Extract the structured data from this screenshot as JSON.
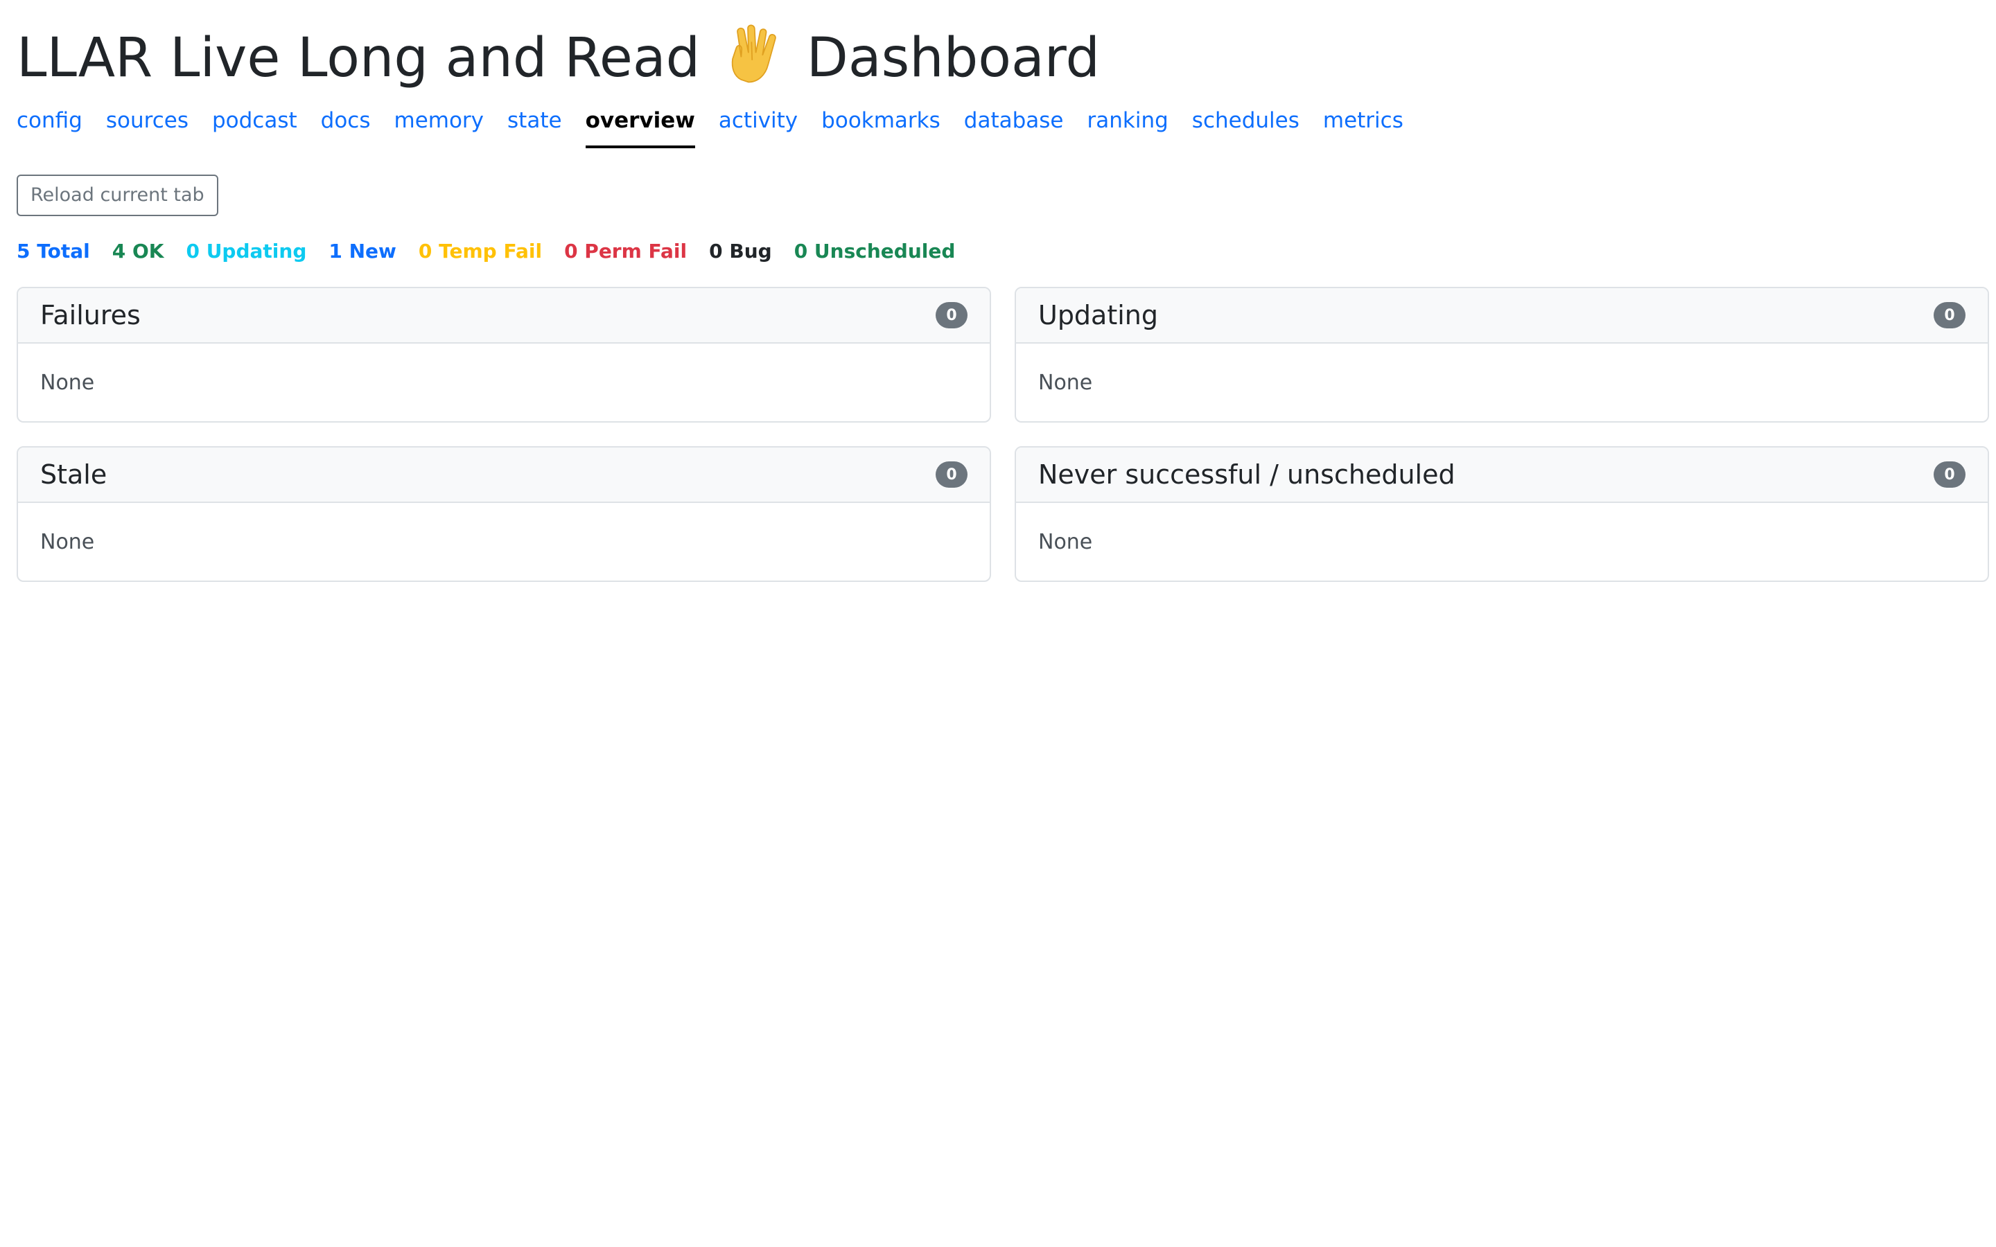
{
  "header": {
    "title_prefix": "LLAR Live Long and Read",
    "title_suffix": "Dashboard",
    "emoji_icon": "vulcan-salute-icon"
  },
  "tabs": [
    {
      "label": "config",
      "active": false
    },
    {
      "label": "sources",
      "active": false
    },
    {
      "label": "podcast",
      "active": false
    },
    {
      "label": "docs",
      "active": false
    },
    {
      "label": "memory",
      "active": false
    },
    {
      "label": "state",
      "active": false
    },
    {
      "label": "overview",
      "active": true
    },
    {
      "label": "activity",
      "active": false
    },
    {
      "label": "bookmarks",
      "active": false
    },
    {
      "label": "database",
      "active": false
    },
    {
      "label": "ranking",
      "active": false
    },
    {
      "label": "schedules",
      "active": false
    },
    {
      "label": "metrics",
      "active": false
    }
  ],
  "toolbar": {
    "reload_label": "Reload current tab"
  },
  "stats": [
    {
      "label": "5 Total",
      "color": "#0d6efd"
    },
    {
      "label": "4 OK",
      "color": "#198754"
    },
    {
      "label": "0 Updating",
      "color": "#0dcaf0"
    },
    {
      "label": "1 New",
      "color": "#0d6efd"
    },
    {
      "label": "0 Temp Fail",
      "color": "#ffc107"
    },
    {
      "label": "0 Perm Fail",
      "color": "#dc3545"
    },
    {
      "label": "0 Bug",
      "color": "#212529"
    },
    {
      "label": "0 Unscheduled",
      "color": "#198754"
    }
  ],
  "panels": [
    {
      "title": "Failures",
      "count": "0",
      "body": "None"
    },
    {
      "title": "Updating",
      "count": "0",
      "body": "None"
    },
    {
      "title": "Stale",
      "count": "0",
      "body": "None"
    },
    {
      "title": "Never successful / unscheduled",
      "count": "0",
      "body": "None"
    }
  ],
  "colors": {
    "link": "#0d6efd",
    "badge": "#6c757d",
    "card_border": "#dee2e6",
    "card_header_bg": "#f8f9fa"
  }
}
